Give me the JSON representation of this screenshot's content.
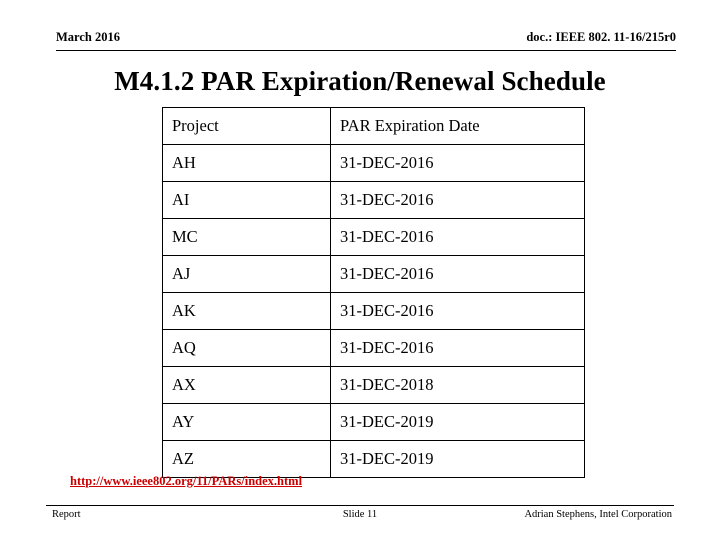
{
  "header": {
    "left": "March 2016",
    "right": "doc.: IEEE 802. 11-16/215r0"
  },
  "title": "M4.1.2 PAR Expiration/Renewal Schedule",
  "table": {
    "columns": [
      "Project",
      "PAR Expiration Date"
    ],
    "rows": [
      [
        "AH",
        "31-DEC-2016"
      ],
      [
        "AI",
        "31-DEC-2016"
      ],
      [
        "MC",
        "31-DEC-2016"
      ],
      [
        "AJ",
        "31-DEC-2016"
      ],
      [
        "AK",
        "31-DEC-2016"
      ],
      [
        "AQ",
        "31-DEC-2016"
      ],
      [
        "AX",
        "31-DEC-2018"
      ],
      [
        "AY",
        "31-DEC-2019"
      ],
      [
        "AZ",
        "31-DEC-2019"
      ]
    ]
  },
  "link": {
    "text": "http://www.ieee802.org/11/PARs/index.html",
    "color": "#cc0000"
  },
  "footer": {
    "left": "Report",
    "center": "Slide 11",
    "right": "Adrian Stephens, Intel Corporation"
  }
}
